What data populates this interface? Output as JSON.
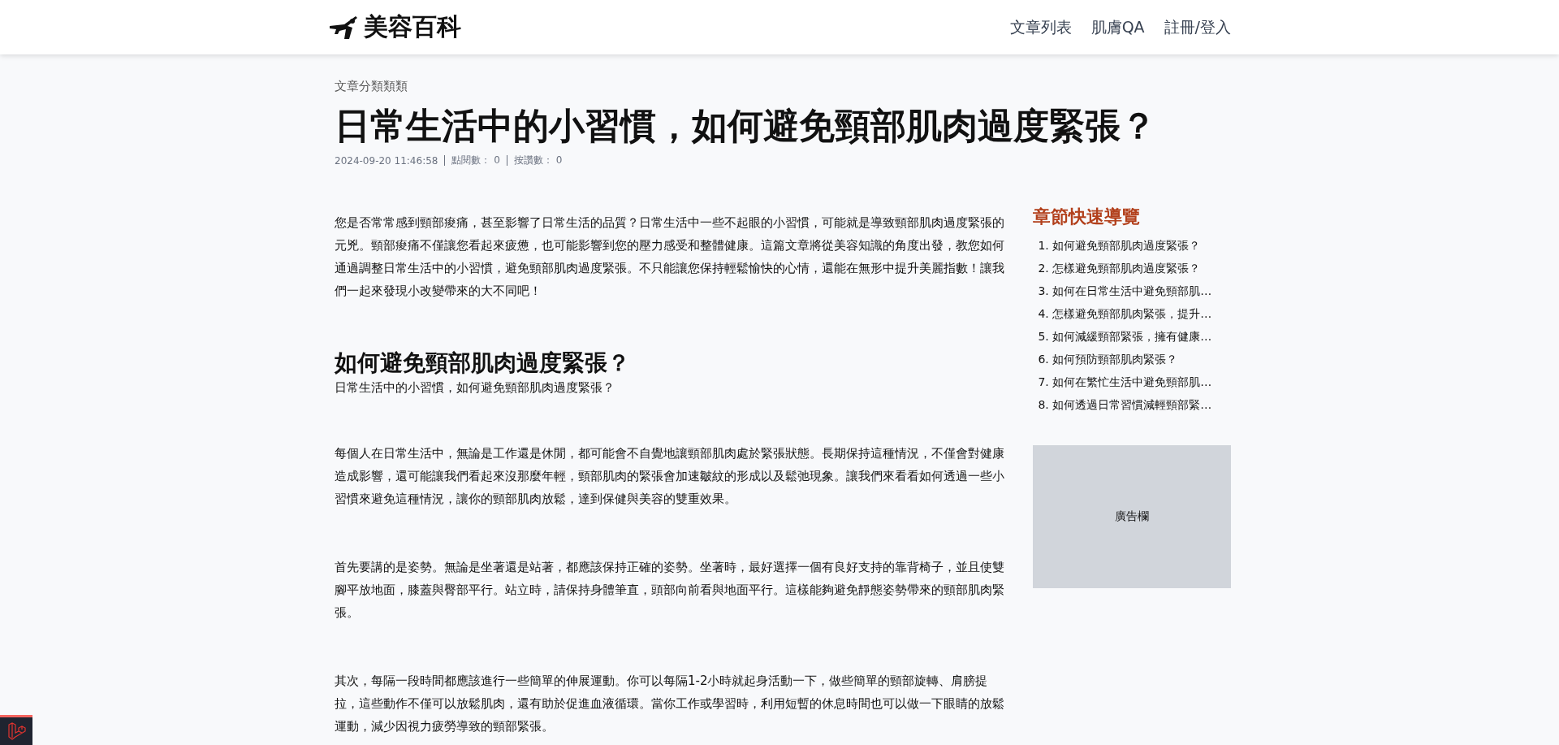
{
  "header": {
    "logo_text": "美容百科",
    "nav": [
      {
        "label": "文章列表"
      },
      {
        "label": "肌膚QA"
      },
      {
        "label": "註冊/登入"
      }
    ]
  },
  "article": {
    "category": "文章分類類類",
    "title": "日常生活中的小習慣，如何避免頸部肌肉過度緊張？",
    "meta": [
      "2024-09-20 11:46:58",
      "點閱數： 0",
      "按讚數： 0"
    ],
    "blocks": [
      {
        "kind": "paragraph",
        "text": "您是否常常感到頸部痠痛，甚至影響了日常生活的品質？日常生活中一些不起眼的小習慣，可能就是導致頸部肌肉過度緊張的元兇。頸部痠痛不僅讓您看起來疲憊，也可能影響到您的壓力感受和整體健康。這篇文章將從美容知識的角度出發，教您如何通過調整日常生活中的小習慣，避免頸部肌肉過度緊張。不只能讓您保持輕鬆愉快的心情，還能在無形中提升美麗指數！讓我們一起來發現小改變帶來的大不同吧！"
      },
      {
        "kind": "heading",
        "text": "如何避免頸部肌肉過度緊張？"
      },
      {
        "kind": "subtitle",
        "text": "日常生活中的小習慣，如何避免頸部肌肉過度緊張？"
      },
      {
        "kind": "paragraph",
        "text": "每個人在日常生活中，無論是工作還是休閒，都可能會不自覺地讓頸部肌肉處於緊張狀態。長期保持這種情況，不僅會對健康造成影響，還可能讓我們看起來沒那麼年輕，頸部肌肉的緊張會加速皺紋的形成以及鬆弛現象。讓我們來看看如何透過一些小習慣來避免這種情況，讓你的頸部肌肉放鬆，達到保健與美容的雙重效果。"
      },
      {
        "kind": "paragraph",
        "text": "首先要講的是姿勢。無論是坐著還是站著，都應該保持正確的姿勢。坐著時，最好選擇一個有良好支持的靠背椅子，並且使雙腳平放地面，膝蓋與臀部平行。站立時，請保持身體筆直，頭部向前看與地面平行。這樣能夠避免靜態姿勢帶來的頸部肌肉緊張。"
      },
      {
        "kind": "paragraph",
        "text": "其次，每隔一段時間都應該進行一些簡單的伸展運動。你可以每隔1-2小時就起身活動一下，做些簡單的頸部旋轉、肩膀提拉，這些動作不僅可以放鬆肌肉，還有助於促進血液循環。當你工作或學習時，利用短暫的休息時間也可以做一下眼睛的放鬆運動，減少因視力疲勞導致的頸部緊張。"
      }
    ]
  },
  "sidebar": {
    "toc_title": "章節快速導覽",
    "toc": [
      "1. 如何避免頸部肌肉過度緊張？",
      "2. 怎樣避免頸部肌肉過度緊張？",
      "3. 如何在日常生活中避免頸部肌…",
      "4. 怎樣避免頸部肌肉緊張，提升…",
      "5. 如何減緩頸部緊張，擁有健康…",
      "6. 如何預防頸部肌肉緊張？",
      "7. 如何在繁忙生活中避免頸部肌…",
      "8. 如何透過日常習慣減輕頸部緊…"
    ],
    "ad_label": "廣告欄"
  }
}
